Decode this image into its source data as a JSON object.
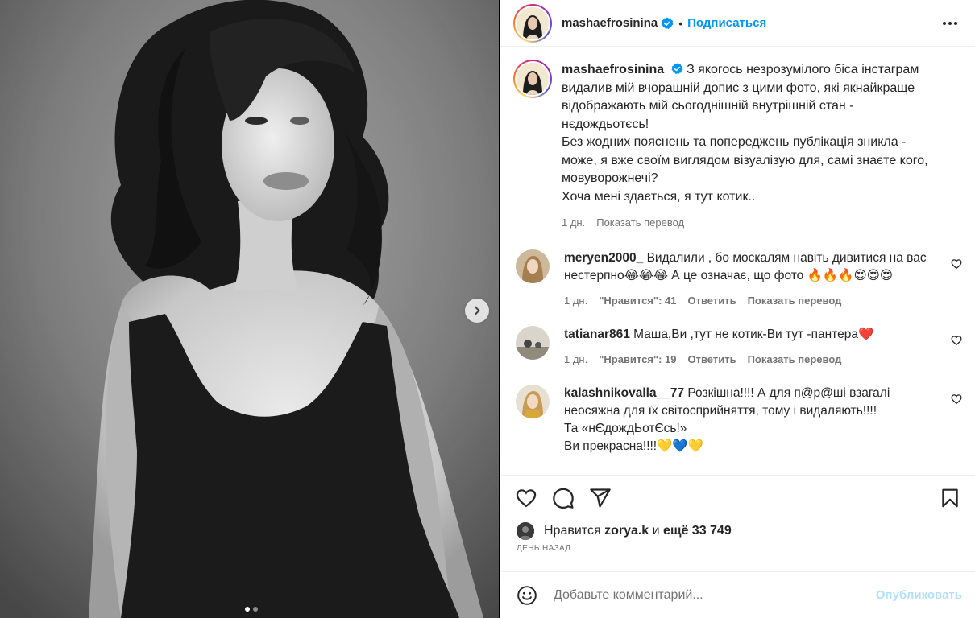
{
  "post": {
    "username": "mashaefrosinina",
    "follow_label": "Подписаться",
    "separator": "•",
    "caption": {
      "username": "mashaefrosinina",
      "text_lines": [
        "З якогось незрозумілого біса інстаграм",
        "видалив мій вчорашній допис з цими фото, які якнайкраще",
        "відображають мій сьогоднішній внутрішній стан -",
        "нєдождьотєсь!",
        "Без жодних пояснень та попереджень публікація зникла -",
        "може, я вже своїм виглядом візуалізую для, самі знаєте кого,",
        "мовуворожнечі?",
        "Хоча мені здається, я тут котик.."
      ],
      "time": "1 дн.",
      "translate": "Показать перевод"
    },
    "comments": [
      {
        "username": "meryen2000_",
        "text": "Видалили , бо москалям навіть дивитися на вас нестерпно😂😂😂 А це означає, що фото 🔥🔥🔥😍😍😍",
        "time": "1 дн.",
        "likes": "\"Нравится\": 41",
        "reply": "Ответить",
        "translate": "Показать перевод"
      },
      {
        "username": "tatianar861",
        "text": "Маша,Ви ,тут не котик-Ви тут -пантера❤️",
        "time": "1 дн.",
        "likes": "\"Нравится\": 19",
        "reply": "Ответить",
        "translate": "Показать перевод"
      },
      {
        "username": "kalashnikovalla__77",
        "text_lines": [
          "Розкішна!!!! А для п@р@ші взагалі",
          "неосяжна для їх світосприйняття, тому і видаляють!!!!",
          "Та «нЄдождЬотЄсь!»",
          "Ви прекрасна!!!!💛💙💛"
        ]
      }
    ],
    "likes": {
      "prefix": "Нравится",
      "user": "zorya.k",
      "and": "и",
      "count_text": "ещё 33 749"
    },
    "date": "ДЕНЬ НАЗАД",
    "add_comment": {
      "placeholder": "Добавьте комментарий...",
      "publish": "Опубликовать"
    },
    "carousel": {
      "total": 2,
      "current": 1
    }
  },
  "colors": {
    "accent": "#0095f6",
    "verified": "#0095f6",
    "text": "#262626",
    "muted": "#737373"
  }
}
